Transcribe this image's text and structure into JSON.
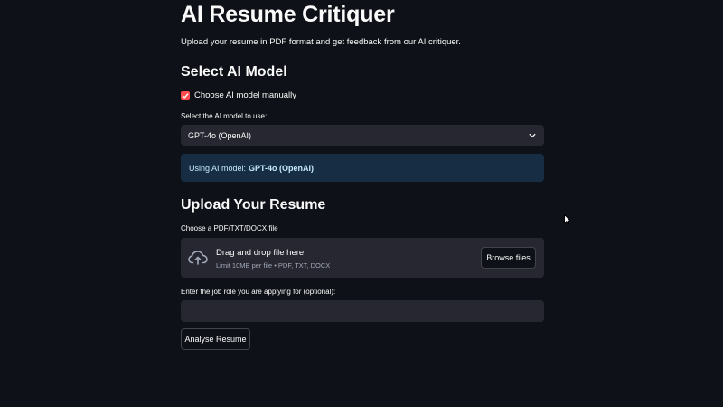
{
  "page": {
    "title": "AI Resume Critiquer",
    "subtitle": "Upload your resume in PDF format and get feedback from our AI critiquer."
  },
  "model_section": {
    "heading": "Select AI Model",
    "checkbox": {
      "label": "Choose AI model manually",
      "checked": true
    },
    "select": {
      "label": "Select the AI model to use:",
      "value": "GPT-4o (OpenAI)",
      "icon": "chevron-down-icon"
    },
    "info": {
      "prefix": "Using AI model:",
      "model_name": "GPT-4o (OpenAI)"
    }
  },
  "upload_section": {
    "heading": "Upload Your Resume",
    "file_label": "Choose a PDF/TXT/DOCX file",
    "dropzone": {
      "icon": "cloud-upload-icon",
      "title": "Drag and drop file here",
      "limit": "Limit 10MB per file • PDF, TXT, DOCX",
      "browse_label": "Browse files"
    },
    "job_role": {
      "label": "Enter the job role you are applying for (optional):",
      "value": "",
      "placeholder": ""
    },
    "submit_label": "Analyse Resume"
  },
  "colors": {
    "background": "#0e1117",
    "accent": "#ff4b4b",
    "widget_bg": "#262730",
    "info_bg": "#172d43",
    "info_text": "#c7ebff"
  }
}
